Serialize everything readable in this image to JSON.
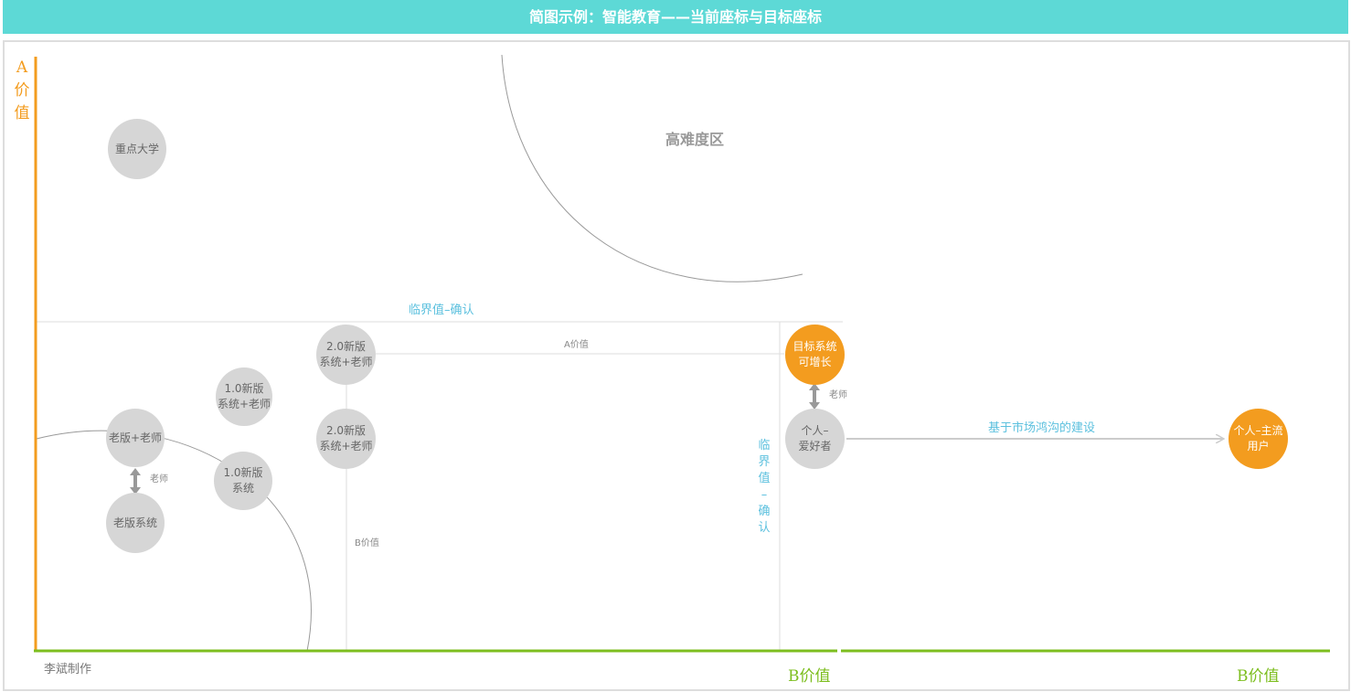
{
  "title": "简图示例：智能教育——当前座标与目标座标",
  "axes": {
    "y_label_chars": [
      "A",
      "价",
      "值"
    ],
    "x_label_current": "B价值",
    "x_label_target": "B价值"
  },
  "zone": {
    "high_difficulty": "高难度区"
  },
  "threshold": {
    "horizontal": "临界值–确认",
    "vertical_chars": [
      "临",
      "界",
      "值",
      "–",
      "确",
      "认"
    ]
  },
  "guides": {
    "a_value": "A价值",
    "b_value": "B价值"
  },
  "nodes": {
    "key_university": "重点大学",
    "old_plus_teacher": "老版+老师",
    "old_system": "老版系统",
    "v1_plus_teacher": "1.0新版\n系统+老师",
    "v1_system": "1.0新版\n系统",
    "v2_plus_teacher_top": "2.0新版\n系统+老师",
    "v2_plus_teacher_mid": "2.0新版\n系统+老师",
    "target_system": "目标系统\n可增长",
    "individual_enthusiast": "个人–\n爱好者",
    "mainstream_user": "个人–主流\n用户"
  },
  "arrows": {
    "teacher_left": "老师",
    "teacher_right": "老师",
    "market_building": "基于市场鸿沟的建设"
  },
  "author": "李斌制作",
  "colors": {
    "banner": "#5dd9d6",
    "axis_y": "#f39c1f",
    "axis_x": "#7dbe1f",
    "node_grey": "#d6d6d6",
    "node_orange": "#f39c1f",
    "threshold_text": "#5bc0de"
  }
}
